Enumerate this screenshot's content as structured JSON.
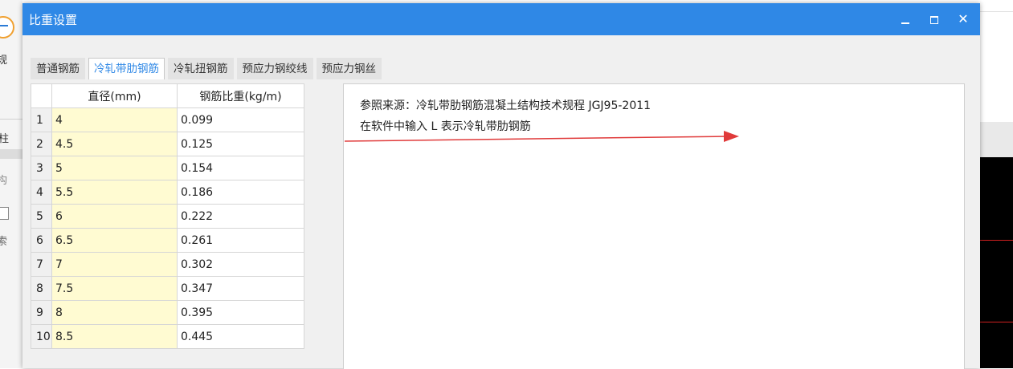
{
  "dialog": {
    "title": "比重设置",
    "controls": {
      "minimize": "minimize",
      "maximize": "maximize",
      "close": "✕"
    }
  },
  "tabs": [
    {
      "label": "普通钢筋",
      "active": false
    },
    {
      "label": "冷轧带肋钢筋",
      "active": true
    },
    {
      "label": "冷轧扭钢筋",
      "active": false
    },
    {
      "label": "预应力钢绞线",
      "active": false
    },
    {
      "label": "预应力钢丝",
      "active": false
    }
  ],
  "table": {
    "headers": {
      "diameter": "直径(mm)",
      "weight": "钢筋比重(kg/m)"
    },
    "rows": [
      {
        "index": "1",
        "diameter": "4",
        "weight": "0.099"
      },
      {
        "index": "2",
        "diameter": "4.5",
        "weight": "0.125"
      },
      {
        "index": "3",
        "diameter": "5",
        "weight": "0.154"
      },
      {
        "index": "4",
        "diameter": "5.5",
        "weight": "0.186"
      },
      {
        "index": "5",
        "diameter": "6",
        "weight": "0.222"
      },
      {
        "index": "6",
        "diameter": "6.5",
        "weight": "0.261"
      },
      {
        "index": "7",
        "diameter": "7",
        "weight": "0.302"
      },
      {
        "index": "8",
        "diameter": "7.5",
        "weight": "0.347"
      },
      {
        "index": "9",
        "diameter": "8",
        "weight": "0.395"
      },
      {
        "index": "10",
        "diameter": "8.5",
        "weight": "0.445"
      }
    ]
  },
  "notes": {
    "line1": "参照来源：冷轧带肋钢筋混凝土结构技术规程 JGJ95-2011",
    "line2": "在软件中输入 L 表示冷轧带肋钢筋"
  },
  "background": {
    "fragments": [
      "规",
      "柱",
      "构",
      "索"
    ]
  },
  "colors": {
    "titlebar": "#2f88e6",
    "active_tab_text": "#2f88e6",
    "diameter_cell": "#fffbd2",
    "arrow": "#e03a3a"
  }
}
